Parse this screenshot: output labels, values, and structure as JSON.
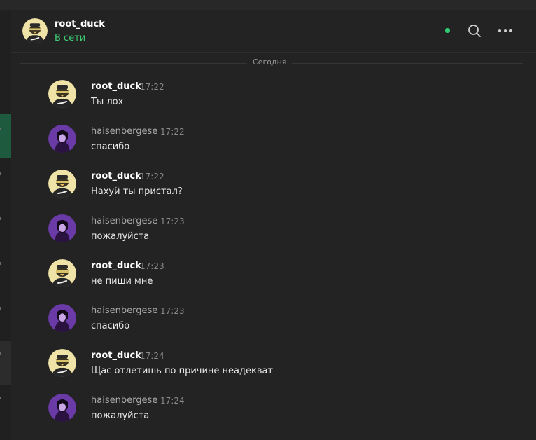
{
  "chat": {
    "title": "root_duck",
    "status": "В сети",
    "status_color": "#3ecf76",
    "online_dot_color": "#2ecc71",
    "header_icons": [
      "search-icon",
      "more-icon"
    ]
  },
  "day_separator": "Сегодня",
  "messages": [
    {
      "author": "root_duck",
      "time": "17:22",
      "text": "Ты лох",
      "self": true
    },
    {
      "author": "haisenbergese",
      "time": "17:22",
      "text": "спасибо",
      "self": false
    },
    {
      "author": "root_duck",
      "time": "17:22",
      "text": "Нахуй ты пристал?",
      "self": true
    },
    {
      "author": "haisenbergese",
      "time": "17:23",
      "text": "пожалуйста",
      "self": false
    },
    {
      "author": "root_duck",
      "time": "17:23",
      "text": "не пиши мне",
      "self": true
    },
    {
      "author": "haisenbergese",
      "time": "17:23",
      "text": "спасибо",
      "self": false
    },
    {
      "author": "root_duck",
      "time": "17:24",
      "text": "Щас отлетишь по причине неадекват",
      "self": true
    },
    {
      "author": "haisenbergese",
      "time": "17:24",
      "text": "пожалуйста",
      "self": false
    }
  ]
}
